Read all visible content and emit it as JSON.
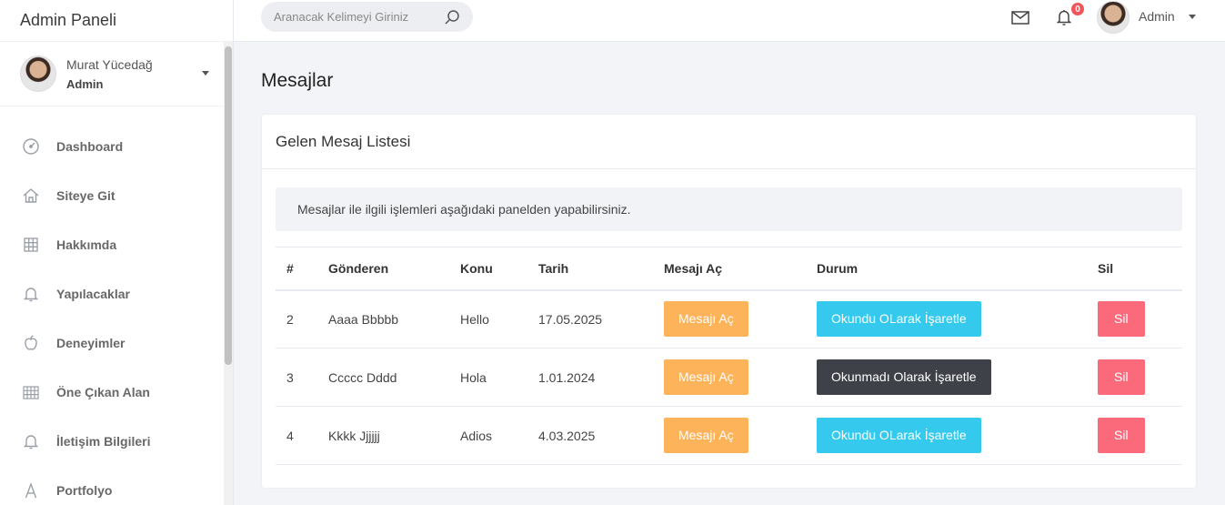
{
  "brand": "Admin Paneli",
  "profile": {
    "name": "Murat Yücedağ",
    "role": "Admin"
  },
  "nav": [
    {
      "label": "Dashboard",
      "icon": "dashboard-icon"
    },
    {
      "label": "Siteye Git",
      "icon": "home-icon"
    },
    {
      "label": "Hakkımda",
      "icon": "grid-icon"
    },
    {
      "label": "Yapılacaklar",
      "icon": "bell-icon"
    },
    {
      "label": "Deneyimler",
      "icon": "apple-icon"
    },
    {
      "label": "Öne Çıkan Alan",
      "icon": "table-icon"
    },
    {
      "label": "İletişim Bilgileri",
      "icon": "bell-icon"
    },
    {
      "label": "Portfolyo",
      "icon": "font-icon"
    }
  ],
  "topbar": {
    "search_placeholder": "Aranacak Kelimeyi Giriniz",
    "notification_count": "0",
    "user_label": "Admin"
  },
  "page": {
    "title": "Mesajlar",
    "card_title": "Gelen Mesaj Listesi",
    "info": "Mesajlar ile ilgili işlemleri aşağıdaki panelden yapabilirsiniz."
  },
  "table": {
    "headers": [
      "#",
      "Gönderen",
      "Konu",
      "Tarih",
      "Mesajı Aç",
      "Durum",
      "Sil"
    ],
    "rows": [
      {
        "id": "2",
        "sender": "Aaaa Bbbbb",
        "topic": "Hello",
        "date": "17.05.2025",
        "open_label": "Mesajı Aç",
        "status_label": "Okundu OLarak İşaretle",
        "status_kind": "read",
        "delete_label": "Sil"
      },
      {
        "id": "3",
        "sender": "Ccccc Dddd",
        "topic": "Hola",
        "date": "1.01.2024",
        "open_label": "Mesajı Aç",
        "status_label": "Okunmadı Olarak İşaretle",
        "status_kind": "unread",
        "delete_label": "Sil"
      },
      {
        "id": "4",
        "sender": "Kkkk Jjjjjj",
        "topic": "Adios",
        "date": "4.03.2025",
        "open_label": "Mesajı Aç",
        "status_label": "Okundu OLarak İşaretle",
        "status_kind": "read",
        "delete_label": "Sil"
      }
    ]
  },
  "colors": {
    "open_button": "#fdb35a",
    "read_button": "#35c9ee",
    "unread_button": "#3e4147",
    "delete_button": "#fb6a7a",
    "badge": "#f2545b"
  }
}
